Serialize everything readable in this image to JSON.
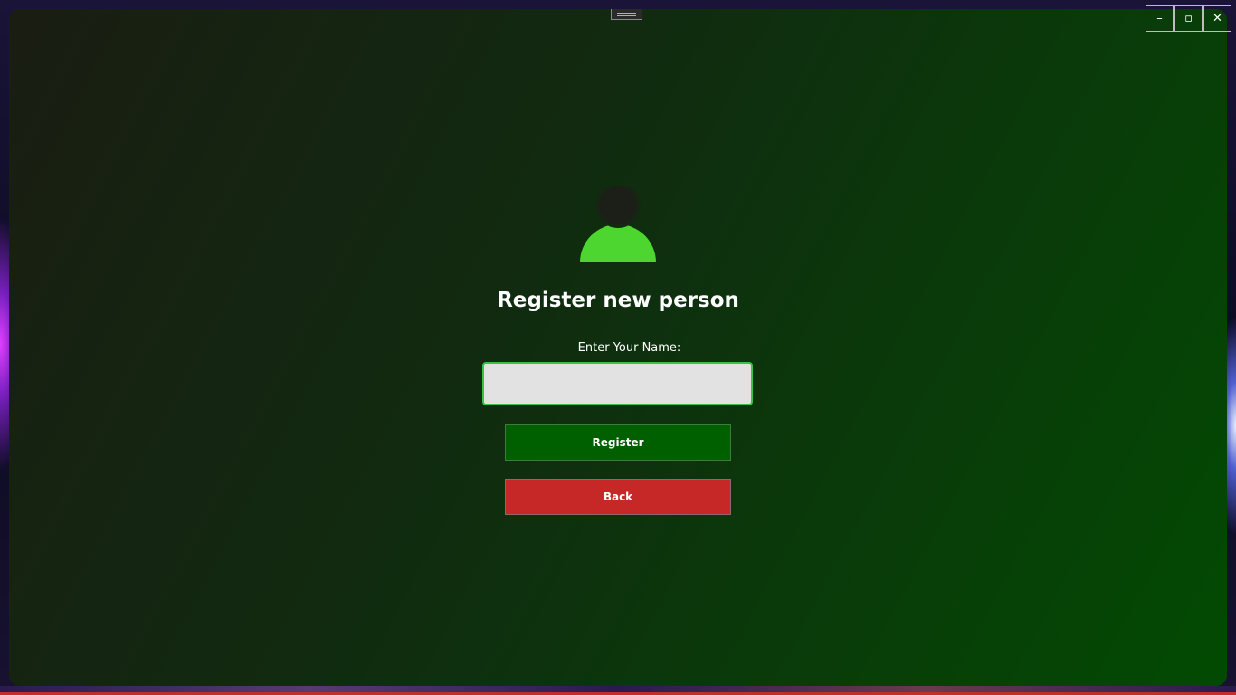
{
  "window": {
    "controls": {
      "minimize_glyph": "–",
      "maximize_glyph": "▫",
      "close_glyph": "✕"
    }
  },
  "form": {
    "avatar_icon": "person-icon",
    "title": "Register new person",
    "name_label": "Enter Your Name:",
    "name_value": "",
    "name_placeholder": "",
    "register_label": "Register",
    "back_label": "Back"
  },
  "colors": {
    "accent_green": "#4cd62f",
    "register_bg": "#006000",
    "back_bg": "#c62828",
    "input_border": "#35c449"
  }
}
